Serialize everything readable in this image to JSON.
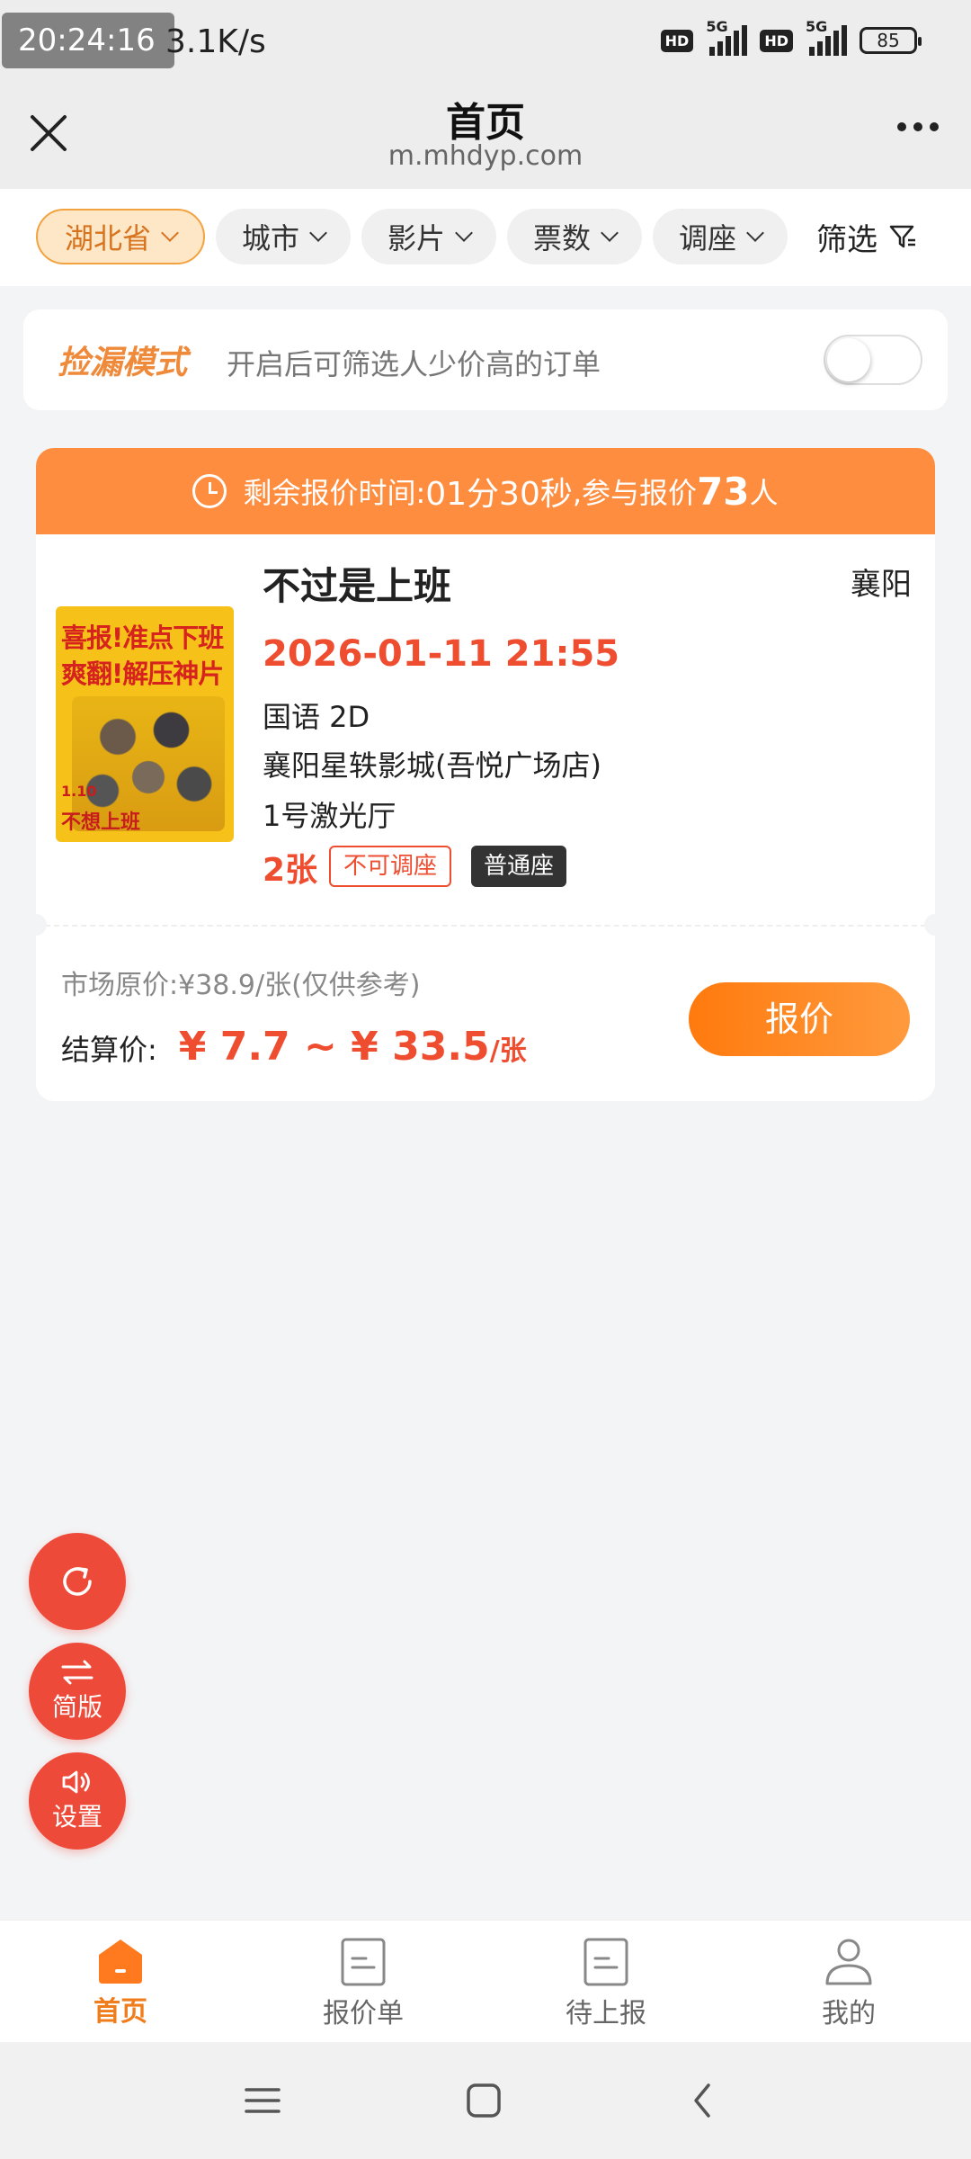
{
  "status_bar": {
    "time": "20:24:16",
    "net_speed": "3.1K/s",
    "sim1_hd": "HD",
    "sim1_network": "5G",
    "sim2_hd": "HD",
    "sim2_network": "5G",
    "battery": "85"
  },
  "header": {
    "title": "首页",
    "domain": "m.mhdyp.com"
  },
  "filters": [
    {
      "label": "湖北省",
      "active": true
    },
    {
      "label": "城市",
      "active": false
    },
    {
      "label": "影片",
      "active": false
    },
    {
      "label": "票数",
      "active": false
    },
    {
      "label": "调座",
      "active": false
    }
  ],
  "filter_button": "筛选",
  "pick_mode": {
    "title": "捡漏模式",
    "description": "开启后可筛选人少价高的订单",
    "enabled": false
  },
  "order": {
    "countdown_label": "剩余报价时间:",
    "countdown": "01分30秒",
    "participants_prefix": ",参与报价",
    "participants_count": "73",
    "participants_suffix": "人",
    "poster": {
      "line1": "喜报!准点下班",
      "line2": "爽翻!解压神片",
      "date": "1.10",
      "name": "不想上班"
    },
    "movie_title": "不过是上班",
    "city": "襄阳",
    "showtime": "2026-01-11 21:55",
    "language_format": "国语 2D",
    "cinema": "襄阳星轶影城(吾悦广场店)",
    "hall": "1号激光厅",
    "tickets": "2张",
    "seat_adjust_tag": "不可调座",
    "seat_type_tag": "普通座",
    "market_price": "市场原价:¥38.9/张(仅供参考)",
    "settle_label": "结算价:",
    "settle_price": "¥ 7.7 ~ ¥ 33.5",
    "settle_unit": "/张",
    "quote_button": "报价"
  },
  "floating_buttons": {
    "refresh_icon": "refresh-icon",
    "simple_label": "简版",
    "settings_label": "设置"
  },
  "tabs": [
    {
      "label": "首页",
      "icon": "home-icon",
      "active": true
    },
    {
      "label": "报价单",
      "icon": "document-icon",
      "active": false
    },
    {
      "label": "待上报",
      "icon": "document-icon",
      "active": false
    },
    {
      "label": "我的",
      "icon": "user-icon",
      "active": false
    }
  ],
  "colors": {
    "accent": "#fe8d3f",
    "price_red": "#ee4d30",
    "fab_red": "#ee4a3a",
    "tab_active": "#f07d1c"
  }
}
